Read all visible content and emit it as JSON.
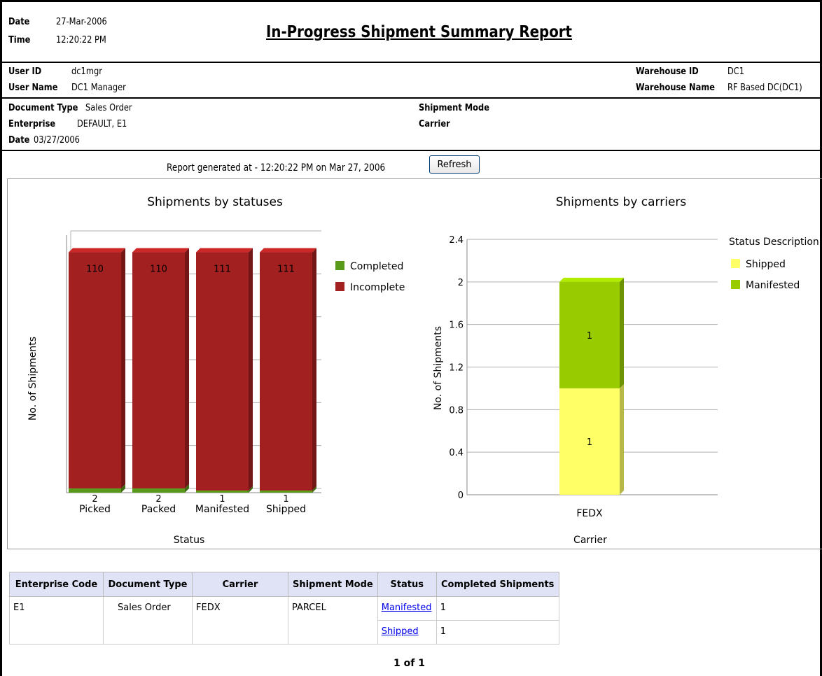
{
  "header": {
    "date_label": "Date",
    "date_value": "27-Mar-2006",
    "time_label": "Time",
    "time_value": "12:20:22 PM",
    "title": "In-Progress Shipment Summary Report"
  },
  "user": {
    "user_id_label": "User ID",
    "user_id": "dc1mgr",
    "user_name_label": "User Name",
    "user_name": "DC1 Manager",
    "warehouse_id_label": "Warehouse ID",
    "warehouse_id": "DC1",
    "warehouse_name_label": "Warehouse Name",
    "warehouse_name": "RF Based DC(DC1)"
  },
  "criteria": {
    "doc_type_label": "Document Type",
    "doc_type": "Sales Order",
    "enterprise_label": "Enterprise",
    "enterprise": "DEFAULT, E1",
    "date_label": "Date",
    "date": "03/27/2006",
    "shipment_mode_label": "Shipment Mode",
    "carrier_label": "Carrier"
  },
  "generated": {
    "text": "Report generated at - 12:20:22 PM on  Mar 27, 2006",
    "refresh_label": "Refresh"
  },
  "chart_data": [
    {
      "type": "bar",
      "stacked": true,
      "title": "Shipments by statuses",
      "xlabel": "Status",
      "ylabel": "No. of Shipments",
      "categories": [
        "Picked",
        "Packed",
        "Manifested",
        "Shipped"
      ],
      "series": [
        {
          "name": "Completed",
          "color": "#5a9a1a",
          "values": [
            2,
            2,
            1,
            1
          ]
        },
        {
          "name": "Incomplete",
          "color": "#a32020",
          "values": [
            110,
            110,
            111,
            111
          ]
        }
      ],
      "ylim": [
        0,
        120
      ],
      "grid": true,
      "legend": "right"
    },
    {
      "type": "bar",
      "stacked": true,
      "title": "Shipments by carriers",
      "xlabel": "Carrier",
      "ylabel": "No. of Shipments",
      "categories": [
        "FEDX"
      ],
      "series": [
        {
          "name": "Shipped",
          "color": "#ffff66",
          "values": [
            1
          ]
        },
        {
          "name": "Manifested",
          "color": "#99cc00",
          "values": [
            1
          ]
        }
      ],
      "yticks": [
        "0",
        "0.4",
        "0.8",
        "1.2",
        "1.6",
        "2",
        "2.4"
      ],
      "ylim": [
        0,
        2.4
      ],
      "grid": true,
      "legend_title": "Status Description",
      "legend": "right"
    }
  ],
  "table": {
    "headers": [
      "Enterprise Code",
      "Document Type",
      "Carrier",
      "Shipment Mode",
      "Status",
      "Completed Shipments"
    ],
    "row": {
      "enterprise": "E1",
      "doc_type": "Sales Order",
      "carrier": "FEDX",
      "mode": "PARCEL",
      "statuses": [
        {
          "status": "Manifested",
          "completed": "1"
        },
        {
          "status": "Shipped",
          "completed": "1"
        }
      ]
    }
  },
  "pager": "1 of 1"
}
